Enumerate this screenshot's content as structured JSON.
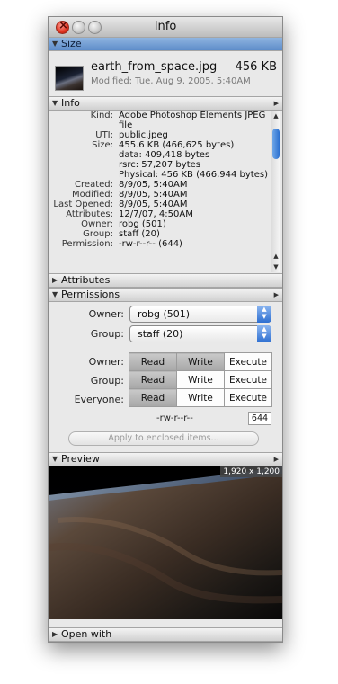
{
  "window": {
    "title": "Info"
  },
  "sections": {
    "size": "Size",
    "info": "Info",
    "attributes": "Attributes",
    "permissions": "Permissions",
    "preview": "Preview",
    "open_with": "Open with"
  },
  "file": {
    "name": "earth_from_space.jpg",
    "size": "456 KB",
    "modified": "Modified: Tue, Aug 9, 2005, 5:40AM"
  },
  "info_rows": [
    {
      "key": "Kind:",
      "value": "Adobe Photoshop Elements JPEG"
    },
    {
      "key": "",
      "value": "file"
    },
    {
      "key": "UTI:",
      "value": "public.jpeg"
    },
    {
      "key": "Size:",
      "value": "455.6 KB (466,625 bytes)"
    },
    {
      "key": "",
      "value": "data: 409,418 bytes"
    },
    {
      "key": "",
      "value": "rsrc: 57,207 bytes"
    },
    {
      "key": "",
      "value": "Physical: 456 KB (466,944 bytes)"
    },
    {
      "key": "Created:",
      "value": "8/9/05, 5:40AM"
    },
    {
      "key": "Modified:",
      "value": "8/9/05, 5:40AM"
    },
    {
      "key": "Last Opened:",
      "value": "8/9/05, 5:40AM"
    },
    {
      "key": "Attributes:",
      "value": "12/7/07, 4:50AM"
    },
    {
      "key": "Owner:",
      "value": "robg (501)"
    },
    {
      "key": "Group:",
      "value": "staff (20)"
    },
    {
      "key": "Permission:",
      "value": "-rw-r--r-- (644)"
    }
  ],
  "permissions": {
    "owner_label": "Owner:",
    "owner_value": "robg (501)",
    "group_label": "Group:",
    "group_value": "staff (20)",
    "columns": [
      "Read",
      "Write",
      "Execute"
    ],
    "rows": [
      {
        "label": "Owner:",
        "read": true,
        "write": true,
        "execute": false
      },
      {
        "label": "Group:",
        "read": true,
        "write": false,
        "execute": false
      },
      {
        "label": "Everyone:",
        "read": true,
        "write": false,
        "execute": false
      }
    ],
    "string": "-rw-r--r--",
    "octal": "644",
    "apply_button": "Apply to enclosed items..."
  },
  "preview": {
    "dimensions": "1,920 x 1,200"
  },
  "icons": {
    "close": "close-button-icon",
    "minimize": "minimize-button-icon",
    "zoom": "zoom-button-icon",
    "expanded": "disclosure-down-icon",
    "collapsed": "disclosure-right-icon"
  },
  "colors": {
    "active_header": "#6f9bd3",
    "accent": "#2e6fd1"
  }
}
